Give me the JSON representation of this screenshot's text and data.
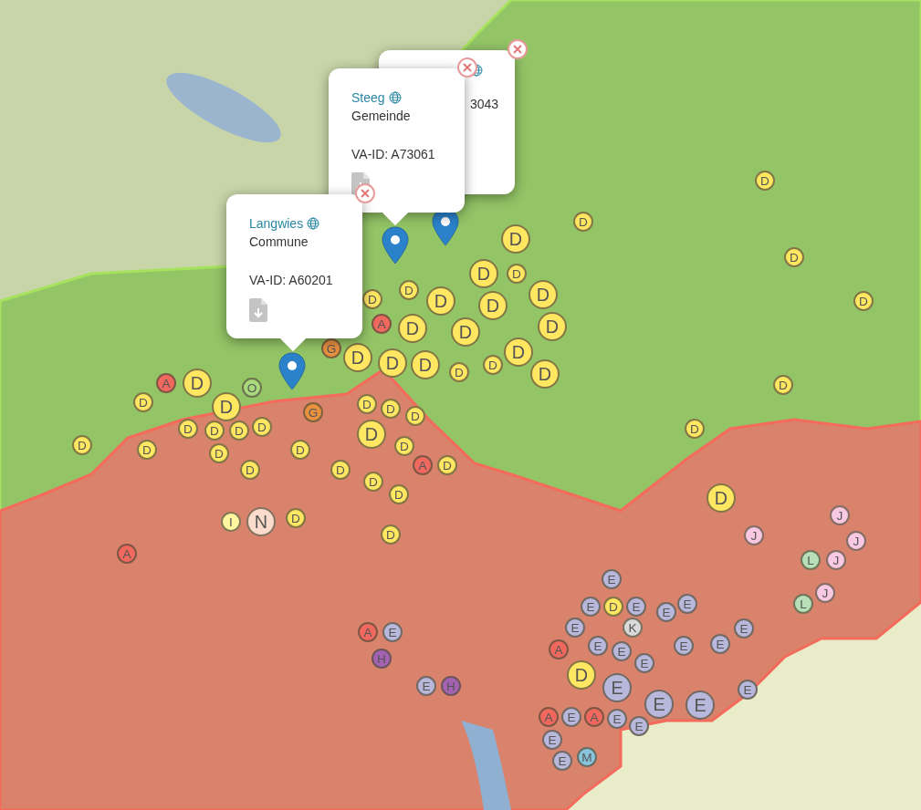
{
  "map": {
    "popups": [
      {
        "kind": "partial",
        "id_text": "3043"
      },
      {
        "kind": "full",
        "title": "Steeg",
        "type": "Gemeinde",
        "id_text": "VA-ID: A73061"
      },
      {
        "kind": "full",
        "title": "Langwies",
        "type": "Commune",
        "id_text": "VA-ID: A60201"
      }
    ],
    "markers": [
      {
        "letter": "D",
        "color": "#ffe761",
        "kind": "small"
      },
      {
        "letter": "D",
        "color": "#ffe761",
        "kind": "small"
      },
      {
        "letter": "D",
        "color": "#ffe761",
        "kind": "large"
      },
      {
        "letter": "D",
        "color": "#ffe761",
        "kind": "small"
      },
      {
        "letter": "D",
        "color": "#ffe761",
        "kind": "large"
      },
      {
        "letter": "D",
        "color": "#ffe761",
        "kind": "small"
      },
      {
        "letter": "D",
        "color": "#ffe761",
        "kind": "small"
      },
      {
        "letter": "D",
        "color": "#ffe761",
        "kind": "small"
      },
      {
        "letter": "D",
        "color": "#ffe761",
        "kind": "large"
      },
      {
        "letter": "D",
        "color": "#ffe761",
        "kind": "large"
      },
      {
        "letter": "D",
        "color": "#ffe761",
        "kind": "large"
      },
      {
        "letter": "D",
        "color": "#ffe761",
        "kind": "small"
      },
      {
        "letter": "A",
        "color": "#f0685e",
        "kind": "small"
      },
      {
        "letter": "D",
        "color": "#ffe761",
        "kind": "large"
      },
      {
        "letter": "D",
        "color": "#ffe761",
        "kind": "large"
      },
      {
        "letter": "D",
        "color": "#ffe761",
        "kind": "large"
      },
      {
        "letter": "G",
        "color": "#e8913f",
        "kind": "small"
      },
      {
        "letter": "D",
        "color": "#ffe761",
        "kind": "large"
      },
      {
        "letter": "D",
        "color": "#ffe761",
        "kind": "large"
      },
      {
        "letter": "D",
        "color": "#ffe761",
        "kind": "large"
      },
      {
        "letter": "D",
        "color": "#ffe761",
        "kind": "small"
      },
      {
        "letter": "D",
        "color": "#ffe761",
        "kind": "small"
      },
      {
        "letter": "D",
        "color": "#ffe761",
        "kind": "large"
      },
      {
        "letter": "D",
        "color": "#ffe761",
        "kind": "large"
      },
      {
        "letter": "A",
        "color": "#f0685e",
        "kind": "small"
      },
      {
        "letter": "D",
        "color": "#ffe761",
        "kind": "large"
      },
      {
        "letter": "O",
        "color": "#a8d97c",
        "kind": "small"
      },
      {
        "letter": "D",
        "color": "#ffe761",
        "kind": "small"
      },
      {
        "letter": "D",
        "color": "#ffe761",
        "kind": "small"
      },
      {
        "letter": "D",
        "color": "#ffe761",
        "kind": "large"
      },
      {
        "letter": "G",
        "color": "#e8913f",
        "kind": "small"
      },
      {
        "letter": "D",
        "color": "#ffe761",
        "kind": "small"
      },
      {
        "letter": "D",
        "color": "#ffe761",
        "kind": "small"
      },
      {
        "letter": "D",
        "color": "#ffe761",
        "kind": "small"
      },
      {
        "letter": "D",
        "color": "#ffe761",
        "kind": "small"
      },
      {
        "letter": "D",
        "color": "#ffe761",
        "kind": "small"
      },
      {
        "letter": "D",
        "color": "#ffe761",
        "kind": "small"
      },
      {
        "letter": "D",
        "color": "#ffe761",
        "kind": "small"
      },
      {
        "letter": "D",
        "color": "#ffe761",
        "kind": "large"
      },
      {
        "letter": "D",
        "color": "#ffe761",
        "kind": "small"
      },
      {
        "letter": "D",
        "color": "#ffe761",
        "kind": "small"
      },
      {
        "letter": "D",
        "color": "#ffe761",
        "kind": "small"
      },
      {
        "letter": "D",
        "color": "#ffe761",
        "kind": "small"
      },
      {
        "letter": "D",
        "color": "#ffe761",
        "kind": "small"
      },
      {
        "letter": "D",
        "color": "#ffe761",
        "kind": "small"
      },
      {
        "letter": "D",
        "color": "#ffe761",
        "kind": "small"
      },
      {
        "letter": "D",
        "color": "#ffe761",
        "kind": "small"
      },
      {
        "letter": "A",
        "color": "#f0685e",
        "kind": "small"
      },
      {
        "letter": "D",
        "color": "#ffe761",
        "kind": "small"
      },
      {
        "letter": "D",
        "color": "#ffe761",
        "kind": "small"
      },
      {
        "letter": "D",
        "color": "#ffe761",
        "kind": "small"
      },
      {
        "letter": "D",
        "color": "#ffe761",
        "kind": "large"
      },
      {
        "letter": "I",
        "color": "#fff6a0",
        "kind": "small"
      },
      {
        "letter": "N",
        "color": "#fbdccc",
        "kind": "large"
      },
      {
        "letter": "D",
        "color": "#ffe761",
        "kind": "small"
      },
      {
        "letter": "J",
        "color": "#f9c8e2",
        "kind": "small"
      },
      {
        "letter": "D",
        "color": "#ffe761",
        "kind": "small"
      },
      {
        "letter": "J",
        "color": "#f9c8e2",
        "kind": "small"
      },
      {
        "letter": "J",
        "color": "#f9c8e2",
        "kind": "small"
      },
      {
        "letter": "A",
        "color": "#f0685e",
        "kind": "small"
      },
      {
        "letter": "L",
        "color": "#b7e0b8",
        "kind": "small"
      },
      {
        "letter": "J",
        "color": "#f9c8e2",
        "kind": "small"
      },
      {
        "letter": "E",
        "color": "#b8b7dc",
        "kind": "small"
      },
      {
        "letter": "J",
        "color": "#f9c8e2",
        "kind": "small"
      },
      {
        "letter": "E",
        "color": "#b8b7dc",
        "kind": "small"
      },
      {
        "letter": "D",
        "color": "#ffe761",
        "kind": "small"
      },
      {
        "letter": "E",
        "color": "#b8b7dc",
        "kind": "small"
      },
      {
        "letter": "E",
        "color": "#b8b7dc",
        "kind": "small"
      },
      {
        "letter": "E",
        "color": "#b8b7dc",
        "kind": "small"
      },
      {
        "letter": "L",
        "color": "#b7e0b8",
        "kind": "small"
      },
      {
        "letter": "A",
        "color": "#f0685e",
        "kind": "small"
      },
      {
        "letter": "E",
        "color": "#b8b7dc",
        "kind": "small"
      },
      {
        "letter": "E",
        "color": "#b8b7dc",
        "kind": "small"
      },
      {
        "letter": "K",
        "color": "#dadada",
        "kind": "small"
      },
      {
        "letter": "E",
        "color": "#b8b7dc",
        "kind": "small"
      },
      {
        "letter": "H",
        "color": "#a463b2",
        "kind": "small"
      },
      {
        "letter": "A",
        "color": "#f0685e",
        "kind": "small"
      },
      {
        "letter": "E",
        "color": "#b8b7dc",
        "kind": "small"
      },
      {
        "letter": "E",
        "color": "#b8b7dc",
        "kind": "small"
      },
      {
        "letter": "E",
        "color": "#b8b7dc",
        "kind": "small"
      },
      {
        "letter": "E",
        "color": "#b8b7dc",
        "kind": "small"
      },
      {
        "letter": "E",
        "color": "#b8b7dc",
        "kind": "small"
      },
      {
        "letter": "D",
        "color": "#ffe761",
        "kind": "large"
      },
      {
        "letter": "E",
        "color": "#b8b7dc",
        "kind": "small"
      },
      {
        "letter": "H",
        "color": "#a463b2",
        "kind": "small"
      },
      {
        "letter": "E",
        "color": "#b8b7dc",
        "kind": "large"
      },
      {
        "letter": "E",
        "color": "#b8b7dc",
        "kind": "small"
      },
      {
        "letter": "E",
        "color": "#b8b7dc",
        "kind": "large"
      },
      {
        "letter": "E",
        "color": "#b8b7dc",
        "kind": "large"
      },
      {
        "letter": "A",
        "color": "#f0685e",
        "kind": "small"
      },
      {
        "letter": "E",
        "color": "#b8b7dc",
        "kind": "small"
      },
      {
        "letter": "A",
        "color": "#f0685e",
        "kind": "small"
      },
      {
        "letter": "E",
        "color": "#b8b7dc",
        "kind": "small"
      },
      {
        "letter": "E",
        "color": "#b8b7dc",
        "kind": "small"
      },
      {
        "letter": "E",
        "color": "#b8b7dc",
        "kind": "small"
      },
      {
        "letter": "E",
        "color": "#b8b7dc",
        "kind": "small"
      },
      {
        "letter": "M",
        "color": "#88c4dc",
        "kind": "small"
      }
    ]
  }
}
